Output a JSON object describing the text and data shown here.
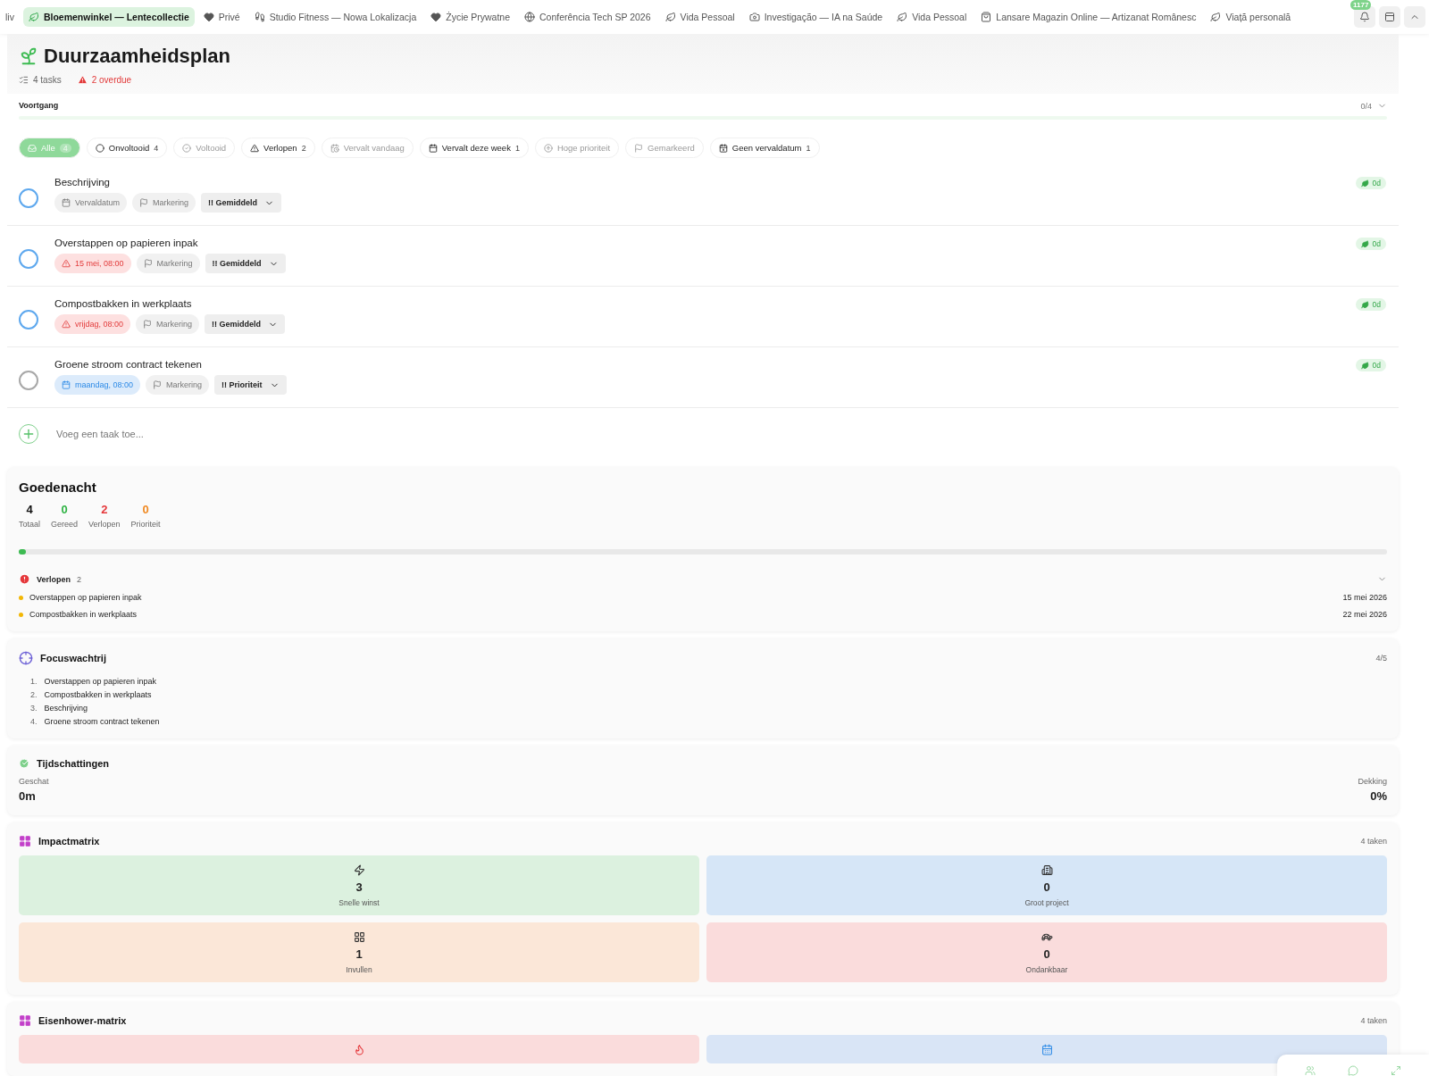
{
  "tabs": [
    {
      "label": "liv",
      "kind": "none",
      "selected": false
    },
    {
      "label": "Bloemenwinkel — Lentecollectie",
      "kind": "leaf",
      "selected": true
    },
    {
      "label": "Privé",
      "kind": "heart",
      "selected": false
    },
    {
      "label": "Studio Fitness — Nowa Lokalizacja",
      "kind": "run",
      "selected": false
    },
    {
      "label": "Życie Prywatne",
      "kind": "heart",
      "selected": false
    },
    {
      "label": "Conferência Tech SP 2026",
      "kind": "globe",
      "selected": false
    },
    {
      "label": "Vida Pessoal",
      "kind": "leaf",
      "selected": false
    },
    {
      "label": "Investigação — IA na Saúde",
      "kind": "camera",
      "selected": false
    },
    {
      "label": "Vida Pessoal",
      "kind": "leaf",
      "selected": false
    },
    {
      "label": "Lansare Magazin Online — Artizanat Românesc",
      "kind": "bag",
      "selected": false
    },
    {
      "label": "Viață personală",
      "kind": "leaf",
      "selected": false
    }
  ],
  "notifications": {
    "badge": "1177"
  },
  "header": {
    "title": "Duurzaamheidsplan",
    "tasks": "4 tasks",
    "overdue": "2 overdue"
  },
  "progress": {
    "label": "Voortgang",
    "count": "0/4",
    "level": 0
  },
  "filters": [
    {
      "label": "Alle",
      "count": "4",
      "kind": "inbox",
      "selected": true,
      "disabled": false
    },
    {
      "label": "Onvoltooid",
      "count": "4",
      "kind": "circle",
      "selected": false,
      "disabled": false
    },
    {
      "label": "Voltooid",
      "kind": "check",
      "selected": false,
      "disabled": true
    },
    {
      "label": "Verlopen",
      "count": "2",
      "kind": "alert",
      "selected": false,
      "disabled": false
    },
    {
      "label": "Vervalt vandaag",
      "kind": "calendar-clock",
      "selected": false,
      "disabled": true
    },
    {
      "label": "Vervalt deze week",
      "count": "1",
      "kind": "calendar",
      "selected": false,
      "disabled": false
    },
    {
      "label": "Hoge prioriteit",
      "kind": "circle-arrow",
      "selected": false,
      "disabled": true
    },
    {
      "label": "Gemarkeerd",
      "kind": "flag",
      "selected": false,
      "disabled": true
    },
    {
      "label": "Geen vervaldatum",
      "count": "1",
      "kind": "calendar-x",
      "selected": false,
      "disabled": false
    }
  ],
  "tasks": [
    {
      "title": "Beschrijving",
      "color": "#5ea8ee",
      "due": {
        "kind": "none",
        "text": "Vervaldatum"
      },
      "flag": "Markering",
      "priority": "!! Gemiddeld",
      "age": "0d"
    },
    {
      "title": "Overstappen op papieren inpak",
      "color": "#5ea8ee",
      "due": {
        "kind": "overdue",
        "text": "15 mei, 08:00"
      },
      "flag": "Markering",
      "priority": "!! Gemiddeld",
      "age": "0d"
    },
    {
      "title": "Compostbakken in werkplaats",
      "color": "#5ea8ee",
      "due": {
        "kind": "overdue",
        "text": "vrijdag, 08:00"
      },
      "flag": "Markering",
      "priority": "!! Gemiddeld",
      "age": "0d"
    },
    {
      "title": "Groene stroom contract tekenen",
      "color": "#a8a8a8",
      "due": {
        "kind": "scheduled",
        "text": "maandag, 08:00"
      },
      "flag": "Markering",
      "priority": "!! Prioriteit",
      "age": "0d"
    }
  ],
  "add_task": {
    "placeholder": "Voeg een taak toe..."
  },
  "summary": {
    "title": "Goedenacht",
    "stats": [
      {
        "value": "4",
        "label": "Totaal",
        "color": "#111111"
      },
      {
        "value": "0",
        "label": "Gereed",
        "color": "#2fb344"
      },
      {
        "value": "2",
        "label": "Verlopen",
        "color": "#e5383b"
      },
      {
        "value": "0",
        "label": "Prioriteit",
        "color": "#f08a24"
      }
    ],
    "level": 0.005,
    "overdue": {
      "title": "Verlopen",
      "count": "2",
      "expanded": true,
      "items": [
        {
          "title": "Overstappen op papieren inpak",
          "date": "15 mei 2026"
        },
        {
          "title": "Compostbakken in werkplaats",
          "date": "22 mei 2026"
        }
      ]
    }
  },
  "focus": {
    "title": "Focuswachtrij",
    "count": "4/5",
    "items": [
      {
        "number": "1.",
        "title": "Overstappen op papieren inpak"
      },
      {
        "number": "2.",
        "title": "Compostbakken in werkplaats"
      },
      {
        "number": "3.",
        "title": "Beschrijving"
      },
      {
        "number": "4.",
        "title": "Groene stroom contract tekenen"
      }
    ]
  },
  "estimates": {
    "title": "Tijdschattingen",
    "estimated_label": "Geschat",
    "estimated": "0m",
    "coverage_label": "Dekking",
    "coverage": "0%"
  },
  "impact": {
    "title": "Impactmatrix",
    "count": "4 taken",
    "quadrants": [
      {
        "kind": "bolt",
        "value": "3",
        "label": "Snelle winst",
        "color": "#dcf1df"
      },
      {
        "kind": "building",
        "value": "0",
        "label": "Groot project",
        "color": "#d6e6f7"
      },
      {
        "kind": "grid",
        "value": "1",
        "label": "Invullen",
        "color": "#fbe7d8"
      },
      {
        "kind": "turtle",
        "value": "0",
        "label": "Ondankbaar",
        "color": "#fadcdc"
      }
    ]
  },
  "eisenhower": {
    "title": "Eisenhower-matrix",
    "count": "4 taken",
    "quadrants": [
      {
        "kind": "flame",
        "color": "#fadcdc"
      },
      {
        "kind": "calendar",
        "color": "#d9e5f6"
      }
    ]
  }
}
